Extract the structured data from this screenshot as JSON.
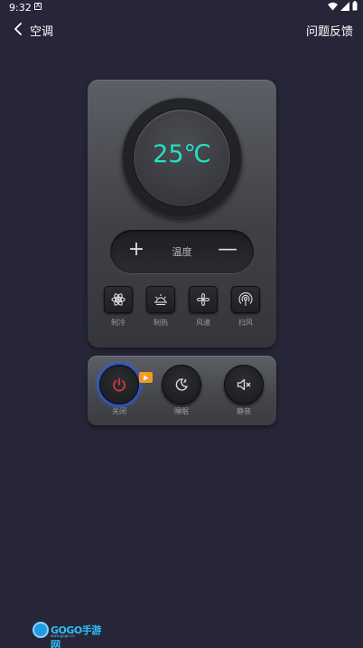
{
  "status_bar": {
    "time": "9:32",
    "notif_icon": "A"
  },
  "header": {
    "title": "空调",
    "feedback": "问题反馈"
  },
  "remote": {
    "temperature": "25℃",
    "temp_label": "温度",
    "plus": "+",
    "minus": "—",
    "modes": [
      {
        "label": "制冷",
        "icon": "snowflake-icon"
      },
      {
        "label": "制热",
        "icon": "sun-icon"
      },
      {
        "label": "风速",
        "icon": "fan-icon"
      },
      {
        "label": "扫风",
        "icon": "swing-icon"
      }
    ],
    "controls": [
      {
        "label": "关闭",
        "icon": "power-icon",
        "active": true
      },
      {
        "label": "睡眠",
        "icon": "moon-icon",
        "active": false
      },
      {
        "label": "静音",
        "icon": "mute-icon",
        "active": false
      }
    ]
  },
  "watermark": {
    "text": "GOGO手游网",
    "sub": "www.gogo.cn"
  },
  "colors": {
    "background": "#262638",
    "accent": "#25e0c4",
    "power": "#e23b3b",
    "badge": "#f39a21"
  }
}
